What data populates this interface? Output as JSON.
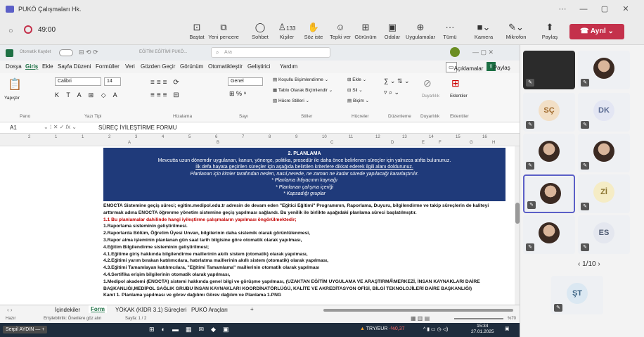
{
  "window": {
    "title": "PUKÖ Çalışmaları Hk."
  },
  "meeting": {
    "timer": "49:00"
  },
  "toolbar": {
    "items": [
      {
        "label": "Baştat",
        "icon": "share-tray-icon"
      },
      {
        "label": "Yeni pencere",
        "icon": "new-window-icon"
      },
      {
        "label": "Sohbet",
        "icon": "chat-icon"
      },
      {
        "label": "Kişiler",
        "icon": "people-icon",
        "count": "133"
      },
      {
        "label": "Söz iste",
        "icon": "raise-hand-icon"
      },
      {
        "label": "Tepki ver",
        "icon": "react-icon"
      },
      {
        "label": "Görünüm",
        "icon": "view-icon"
      },
      {
        "label": "Odalar",
        "icon": "rooms-icon"
      },
      {
        "label": "Uygulamalar",
        "icon": "apps-icon"
      },
      {
        "label": "Tümü",
        "icon": "more-icon"
      },
      {
        "label": "Kamera",
        "icon": "camera-off-icon"
      },
      {
        "label": "Mikrofon",
        "icon": "mic-off-icon"
      },
      {
        "label": "Paylaş",
        "icon": "share-icon"
      }
    ],
    "leave_label": "Ayrıl"
  },
  "excel": {
    "autosave": "Otomatik Kaydet",
    "file_name": "EĞİTİM EĞİTİMİ PUKÖ...",
    "search_placeholder": "Ara",
    "menu": [
      "Dosya",
      "Giriş",
      "Ekle",
      "Sayfa Düzeni",
      "Formüller",
      "Veri",
      "Gözden Geçir",
      "Görünüm",
      "Otomatikleştir",
      "Geliştirici",
      "Yardım"
    ],
    "comments_label": "Açıklamalar",
    "share_label": "Paylaş",
    "ribbon": {
      "paste": "Yapıştır",
      "font_name": "Calibri",
      "font_size": "14",
      "number_format": "Genel",
      "conditional": "Koşullu Biçimlendirme",
      "table_format": "Tablo Olarak Biçimlendir",
      "cell_styles": "Hücre Stilleri",
      "insert": "Ekle",
      "delete": "Sil",
      "format": "Biçim",
      "sensitivity": "Duyarlılık",
      "addins": "Eklentiler",
      "groups": [
        "Pano",
        "Yazı Tipi",
        "Hizalama",
        "Sayı",
        "Stiller",
        "Hücreler",
        "Düzenleme",
        "Duyarlılık",
        "Eklentiler"
      ]
    },
    "name_box": "A1",
    "formula": "SÜREÇ İYİLEŞTİRME FORMU",
    "ruler_numbers": [
      "2",
      "1",
      "1",
      "2",
      "3",
      "4",
      "5",
      "6",
      "7",
      "8",
      "9",
      "10",
      "11",
      "12",
      "13",
      "14",
      "15",
      "16"
    ],
    "col_letters": [
      "A",
      "B",
      "C",
      "D",
      "E",
      "F",
      "G",
      "H"
    ],
    "banner_lines": [
      "2. PLANLAMA",
      "Mevcutta uzun dönemdir uygulanan, kanun, yönerge, politika, prosedür ile daha önce belirlenen süreçler için yalnızca atıfta bulununuz.",
      "İlk defa hayata geçirilen süreçler için aşağıda belirtilen kriterlere dikkat ederek ilgili alanı doldurunuz.",
      "Planlanan için kimler tarafından neden, nasıl,nerede, ne zaman ne kadar sürede yapılacağı kararlaştırılır.",
      "* Planlama ihtiyacının kaynağı",
      "* Planlanan çalışma içeriği",
      "* Kapsadığı gruplar"
    ],
    "body_lines": [
      {
        "text": "ENOCTA Sistemine geçiş süreci; egitim.medipol.edu.tr adresin de devam eden \"Eğitici Eğitimi\" Programının, Raporlama, Duyuru, bilgilendirme ve takip süreçlerin de kaliteyi",
        "red": false
      },
      {
        "text": "arttırmak adına ENOCTA öğrenme yönetim sistemine geçiş yapılması sağlandı. Bu yenilik ile birlikte aşağıdaki planlama süreci başlatılmıştır.",
        "red": false
      },
      {
        "text": "1.1 Bu planlamalar dahilinde  hangi iyileştirme çalışmaların yapılması öngörülmektedir;",
        "red": true
      },
      {
        "text": "1.Raporlama sisteminin geliştirilmesi.",
        "red": false
      },
      {
        "text": "2.Raporlarda Bölüm, Öğretim Üyesi Unvan, bilgilerinin daha sistemik olarak görüntülenmesi,",
        "red": false
      },
      {
        "text": "3.Rapor alma işleminin planlanan gün saat tarih bilgisine göre otomatik olarak yapılması,",
        "red": false
      },
      {
        "text": "4.Eğitim Bilgilendirme sisteminin geliştirilmesi;",
        "red": false
      },
      {
        "text": "4.1.Eğitime giriş hakkında bilgilendirme maillerinin akıllı sistem (otomatik) olarak yapılması,",
        "red": false
      },
      {
        "text": "4.2.Eğitimi yarım bırakan katılımcılara, hatırlatma maillerinin akıllı sistem (otomatik) olarak yapılması,",
        "red": false
      },
      {
        "text": "4.3.Eğitimi Tamamlayan katılımcılara, \"Eğitimi Tamamlama\" maillerinin otomatik olarak yapılması",
        "red": false
      },
      {
        "text": "4.4.Sertifika erişim bilgilerinin otomatik olarak yapılması,",
        "red": false
      },
      {
        "text": "1.Medipol akademi (ENOCTA) sistemi hakkında genel bilgi ve görüşme yapılması, (UZAKTAN EĞİTİM UYGULAMA VE ARAŞTIRMA MERKEZİ, İNSAN KAYNAKLARI DAİRE",
        "red": false
      },
      {
        "text": "BAŞKANLIĞI,MEDİPOL SAĞLIK GRUBU İNSAN KAYNAKLARI KOORDİNATÖRLÜĞÜ, KALİTE VE AKREDİTASYON OFİSİ, BİLGİ TEKNOLOJİLERİ DAİRE BAŞKANLIĞI)",
        "red": false
      },
      {
        "text": "Kanıt 1.  Planlama yapılması ve görev dağılımı Görev dağılım ve Planlama 1.PNG",
        "red": false
      }
    ],
    "sheet_tabs": [
      "İçindekiler",
      "Form",
      "YÖKAK (KİDR 3.1) Süreçleri",
      "PUKÖ Araçları"
    ],
    "status": {
      "ready": "Hazır",
      "accessibility": "Erişilebilirlik: Önerilere göz atın",
      "page": "Sayfa: 1 / 2",
      "zoom": "%70"
    },
    "taskbar": {
      "presenter": "Serpil AYDIN",
      "ticker": "TRY/EUR",
      "ticker_change": "-%0,37",
      "time": "15:34",
      "date": "27.01.2025"
    }
  },
  "participants": [
    {
      "initials": "",
      "kind": "dark"
    },
    {
      "initials": "",
      "kind": "photo"
    },
    {
      "initials": "SÇ",
      "kind": "initials",
      "color": "#f2dfc6",
      "text": "#a06a2c"
    },
    {
      "initials": "DK",
      "kind": "initials",
      "color": "#e3e6f3",
      "text": "#5a6a92"
    },
    {
      "initials": "",
      "kind": "photo"
    },
    {
      "initials": "",
      "kind": "photo"
    },
    {
      "initials": "",
      "kind": "photo"
    },
    {
      "initials": "Zİ",
      "kind": "initials",
      "color": "#f5ecc5",
      "text": "#8a7430"
    },
    {
      "initials": "",
      "kind": "photo"
    },
    {
      "initials": "ES",
      "kind": "initials",
      "color": "#e4e7ef",
      "text": "#4f5b72"
    },
    {
      "initials": "ŞT",
      "kind": "initials",
      "color": "#dbe8f2",
      "text": "#3f6686"
    }
  ],
  "pager": "1/10"
}
